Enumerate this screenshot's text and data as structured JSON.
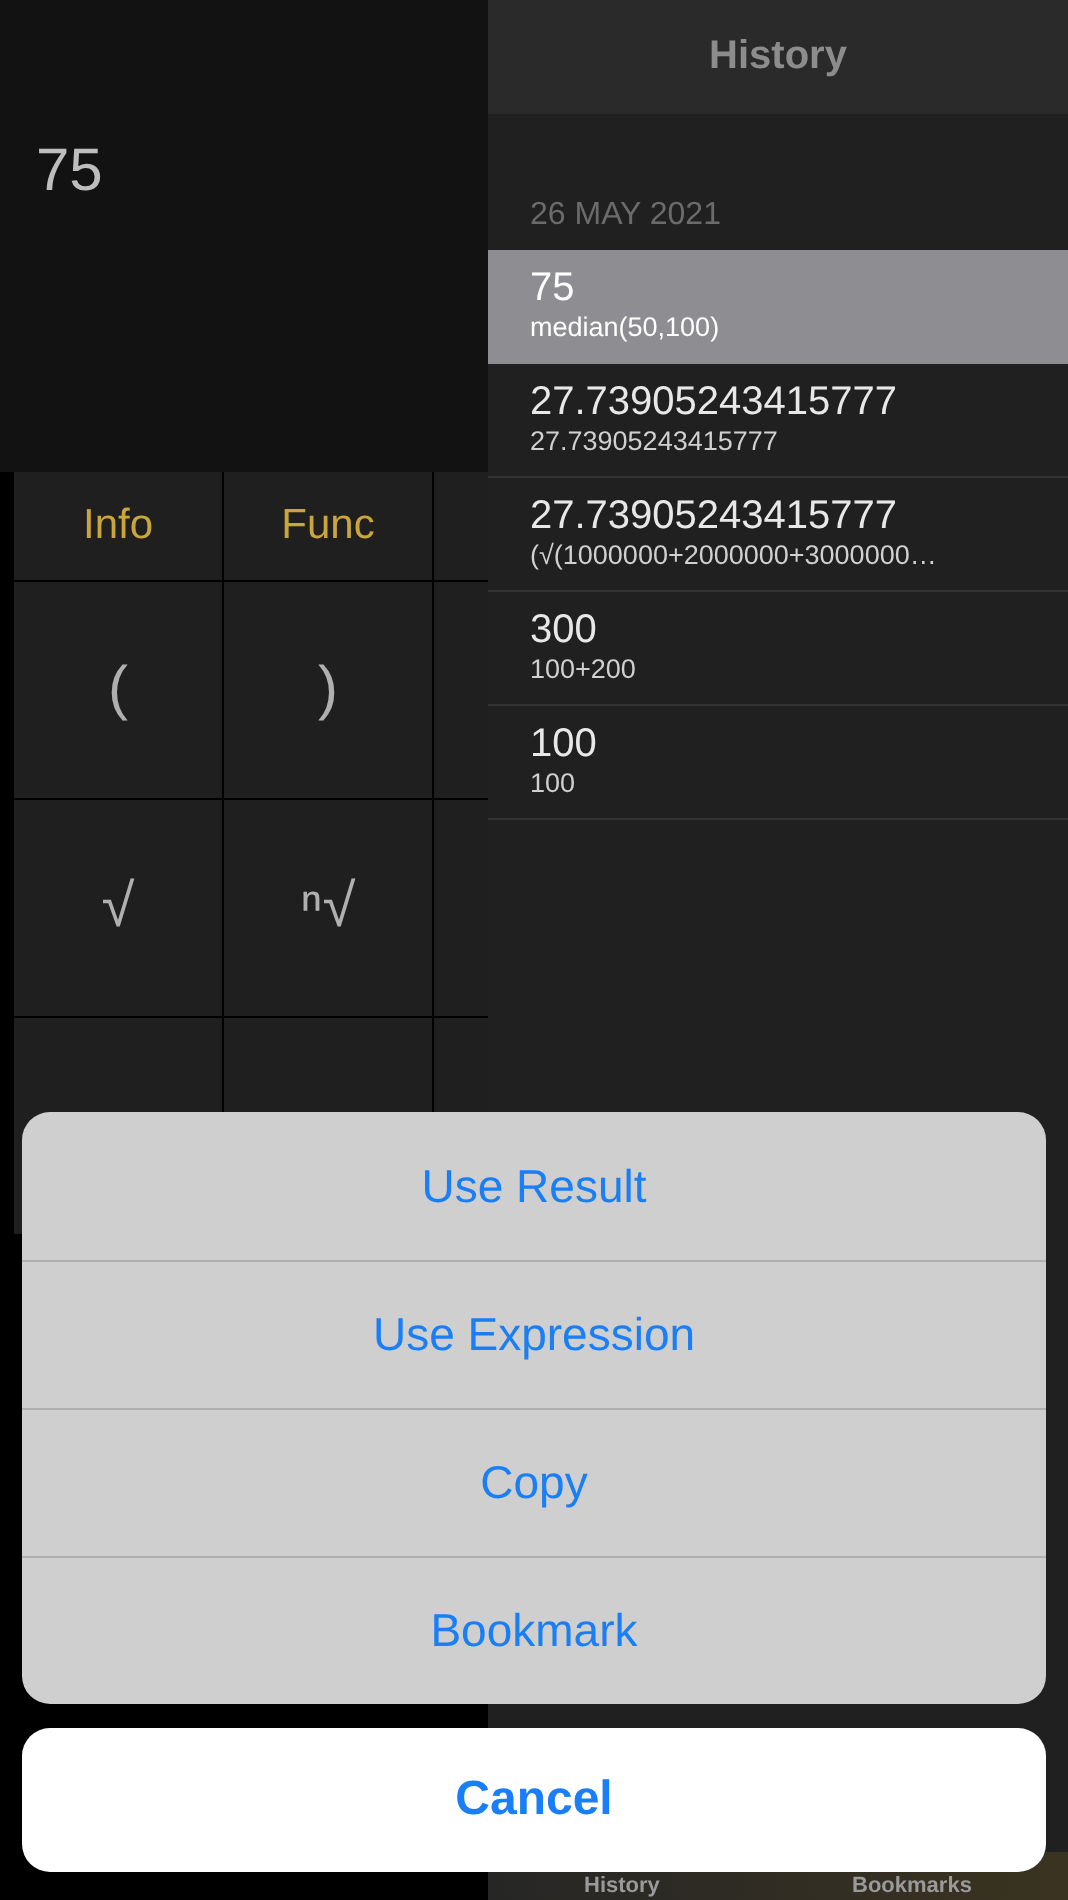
{
  "display": {
    "value": "75"
  },
  "keypad": {
    "rows": [
      [
        "Info",
        "Func"
      ],
      [
        "(",
        ")"
      ],
      [
        "√",
        "ⁿ√"
      ]
    ]
  },
  "history": {
    "title": "History",
    "date": "26 MAY 2021",
    "entries": [
      {
        "result": "75",
        "expression": "median(50,100)",
        "selected": true
      },
      {
        "result": "27.73905243415777",
        "expression": "27.73905243415777",
        "selected": false
      },
      {
        "result": "27.73905243415777",
        "expression": "(√(1000000+2000000+3000000…",
        "selected": false
      },
      {
        "result": "300",
        "expression": "100+200",
        "selected": false
      },
      {
        "result": "100",
        "expression": "100",
        "selected": false
      }
    ]
  },
  "tab_bar": [
    "History",
    "Bookmarks"
  ],
  "action_sheet": {
    "actions": [
      "Use Result",
      "Use Expression",
      "Copy",
      "Bookmark"
    ],
    "cancel": "Cancel"
  }
}
